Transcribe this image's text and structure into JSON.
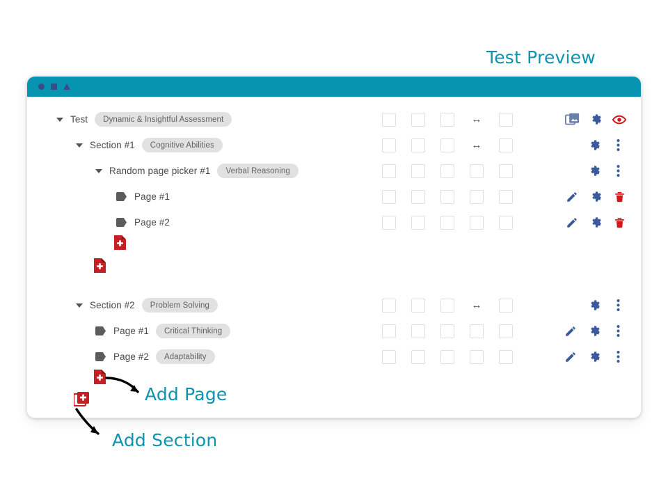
{
  "window": {
    "titlebar_shapes": [
      "circle",
      "square",
      "triangle"
    ],
    "accent_color": "#0794b0"
  },
  "annotations": [
    {
      "id": "test-preview",
      "label": "Test Preview"
    },
    {
      "id": "add-page",
      "label": "Add Page"
    },
    {
      "id": "add-section",
      "label": "Add Section"
    }
  ],
  "tree": {
    "rows": [
      {
        "id": "test",
        "level": 0,
        "icon": "caret-down-icon",
        "label": "Test",
        "badge": "Dynamic & Insightful Assessment",
        "controls": [
          "checkbox",
          "checkbox",
          "checkbox",
          "resize-arrow",
          "checkbox"
        ],
        "actions": [
          "images-icon",
          "gear-icon",
          "eye-icon"
        ]
      },
      {
        "id": "section-1",
        "level": 1,
        "icon": "caret-down-icon",
        "label": "Section #1",
        "badge": "Cognitive Abilities",
        "controls": [
          "checkbox",
          "checkbox",
          "checkbox",
          "resize-arrow",
          "checkbox"
        ],
        "actions": [
          "gear-icon",
          "kebab-menu-icon"
        ]
      },
      {
        "id": "random-page-picker-1",
        "level": 2,
        "icon": "caret-down-icon",
        "label": "Random page picker #1",
        "badge": "Verbal Reasoning",
        "controls": [
          "checkbox",
          "checkbox",
          "checkbox",
          "checkbox",
          "checkbox"
        ],
        "actions": [
          "gear-icon",
          "kebab-menu-icon"
        ]
      },
      {
        "id": "page-1-a",
        "level": 3,
        "icon": "tag-icon",
        "label": "Page #1",
        "badge": "",
        "controls": [
          "checkbox",
          "checkbox",
          "checkbox",
          "checkbox",
          "checkbox"
        ],
        "actions": [
          "pencil-icon",
          "gear-icon",
          "trash-icon"
        ]
      },
      {
        "id": "page-2-a",
        "level": 3,
        "icon": "tag-icon",
        "label": "Page #2",
        "badge": "",
        "controls": [
          "checkbox",
          "checkbox",
          "checkbox",
          "checkbox",
          "checkbox"
        ],
        "actions": [
          "pencil-icon",
          "gear-icon",
          "trash-icon"
        ]
      },
      {
        "id": "section-2",
        "level": 1,
        "icon": "caret-down-icon",
        "label": "Section #2",
        "badge": "Problem Solving",
        "controls": [
          "checkbox",
          "checkbox",
          "checkbox",
          "resize-arrow",
          "checkbox"
        ],
        "actions": [
          "gear-icon",
          "kebab-menu-icon"
        ]
      },
      {
        "id": "page-1-b",
        "level": 2,
        "icon": "tag-icon",
        "label": "Page #1",
        "badge": "Critical Thinking",
        "controls": [
          "checkbox",
          "checkbox",
          "checkbox",
          "checkbox",
          "checkbox"
        ],
        "actions": [
          "pencil-icon",
          "gear-icon",
          "kebab-menu-icon"
        ]
      },
      {
        "id": "page-2-b",
        "level": 2,
        "icon": "tag-icon",
        "label": "Page #2",
        "badge": "Adaptability",
        "controls": [
          "checkbox",
          "checkbox",
          "checkbox",
          "checkbox",
          "checkbox"
        ],
        "actions": [
          "pencil-icon",
          "gear-icon",
          "kebab-menu-icon"
        ]
      }
    ],
    "add_buttons": [
      {
        "id": "add-page-picker",
        "icon": "add-page-icon"
      },
      {
        "id": "add-page-section-1",
        "icon": "add-page-icon"
      },
      {
        "id": "add-page-section-2",
        "icon": "add-page-icon"
      },
      {
        "id": "add-section",
        "icon": "add-section-icon"
      }
    ]
  },
  "colors": {
    "teal": "#0794b0",
    "navy_icon": "#3b5a9c",
    "red_icon": "#d0181b",
    "badge_bg": "#e1e1e1",
    "text": "#4a4a4a",
    "slate": "#6b80a8"
  }
}
